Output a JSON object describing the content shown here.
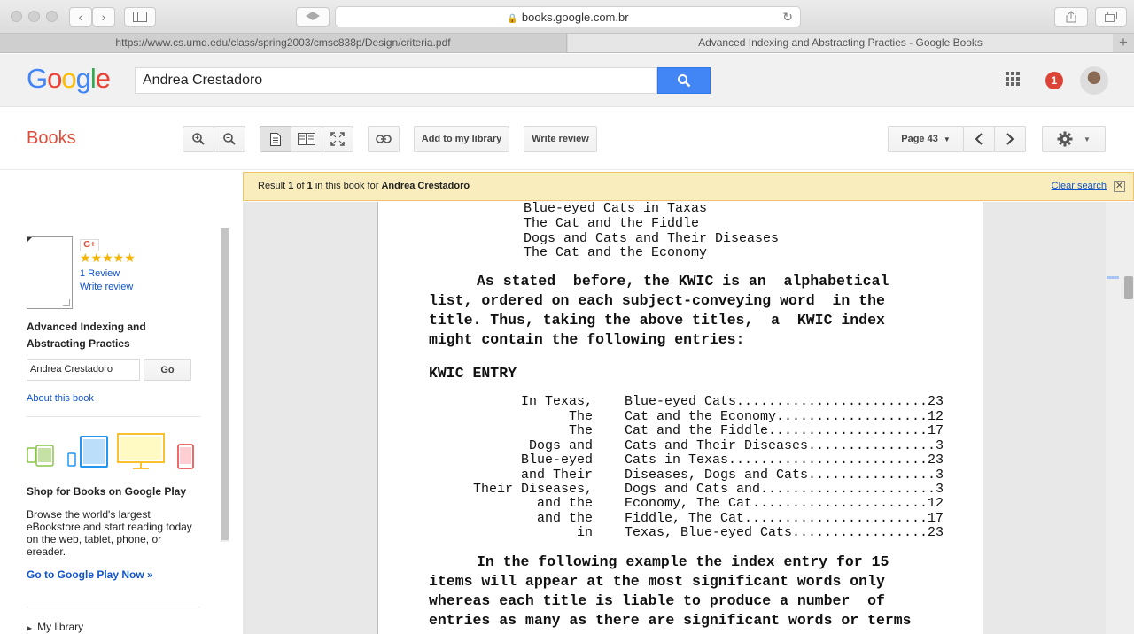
{
  "browser": {
    "url": "books.google.com.br",
    "tabs": [
      {
        "title": "https://www.cs.umd.edu/class/spring2003/cmsc838p/Design/criteria.pdf"
      },
      {
        "title": "Advanced Indexing and Abstracting Practies - Google Books"
      }
    ]
  },
  "header": {
    "logo": "Google",
    "search_query": "Andrea Crestadoro",
    "notification_count": "1"
  },
  "toolbar": {
    "section_title": "Books",
    "add_library": "Add to my library",
    "write_review": "Write review",
    "page_label": "Page 43"
  },
  "result_bar": {
    "prefix": "Result ",
    "current": "1",
    "of_text": " of ",
    "total": "1",
    "middle": " in this book for ",
    "query": "Andrea Crestadoro",
    "clear": "Clear search"
  },
  "sidebar": {
    "gplus": "G+",
    "stars": "★★★★★",
    "rating": 5,
    "reviews": "1 Review",
    "write_review": "Write review",
    "book_title": "Advanced Indexing and Abstracting Practies",
    "search_value": "Andrea Crestadoro",
    "go": "Go",
    "about": "About this book",
    "shop_title": "Shop for Books on Google Play",
    "shop_desc": "Browse the world's largest eBookstore and start reading today on the web, tablet, phone, or ereader.",
    "play_link": "Go to Google Play Now »",
    "my_library": "My library"
  },
  "page": {
    "top_titles": [
      "Blue-eyed Cats in Taxas",
      "The Cat and the Fiddle",
      "Dogs and Cats and Their Diseases",
      "The Cat and the Economy"
    ],
    "para1": [
      "As stated  before, the KWIC is an  alphabetical",
      "list, ordered on each subject-conveying word  in the",
      "title. Thus, taking the above titles,  a  KWIC index",
      "might contain the following entries:"
    ],
    "heading": "KWIC ENTRY",
    "entries": [
      {
        "left": "In Texas,",
        "right": "Blue-eyed Cats........................23"
      },
      {
        "left": "The",
        "right": "Cat and the Economy...................12"
      },
      {
        "left": "The",
        "right": "Cat and the Fiddle....................17"
      },
      {
        "left": "Dogs and",
        "right": "Cats and Their Diseases................3"
      },
      {
        "left": "Blue-eyed",
        "right": "Cats in Texas.........................23"
      },
      {
        "left": "and Their",
        "right": "Diseases, Dogs and Cats................3"
      },
      {
        "left": "Their Diseases,",
        "right": "Dogs and Cats and......................3"
      },
      {
        "left": "and the",
        "right": "Economy, The Cat......................12"
      },
      {
        "left": "and the",
        "right": "Fiddle, The Cat.......................17"
      },
      {
        "left": "in",
        "right": "Texas, Blue-eyed Cats.................23"
      }
    ],
    "para2": [
      "In the following example the index entry for 15",
      "items will appear at the most significant words only",
      "whereas each title is liable to produce a number  of",
      "entries as many as there are significant words or terms"
    ]
  }
}
